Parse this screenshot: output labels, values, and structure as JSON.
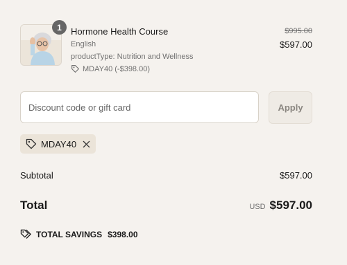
{
  "product": {
    "name": "Hormone Health Course",
    "variant": "English",
    "product_type": "productType: Nutrition and Wellness",
    "discount_applied": "MDAY40 (-$398.00)",
    "original_price": "$995.00",
    "price": "$597.00",
    "quantity": "1",
    "thumbnail_icon": "product-photo"
  },
  "discount": {
    "placeholder": "Discount code or gift card",
    "value": "",
    "apply_label": "Apply",
    "applied_code": "MDAY40"
  },
  "summary": {
    "subtotal_label": "Subtotal",
    "subtotal_value": "$597.00",
    "total_label": "Total",
    "currency": "USD",
    "total_value": "$597.00",
    "savings_label": "TOTAL SAVINGS",
    "savings_value": "$398.00"
  },
  "colors": {
    "background": "#f5f2ee",
    "chip": "#ebe4d9",
    "badge": "#666666"
  }
}
